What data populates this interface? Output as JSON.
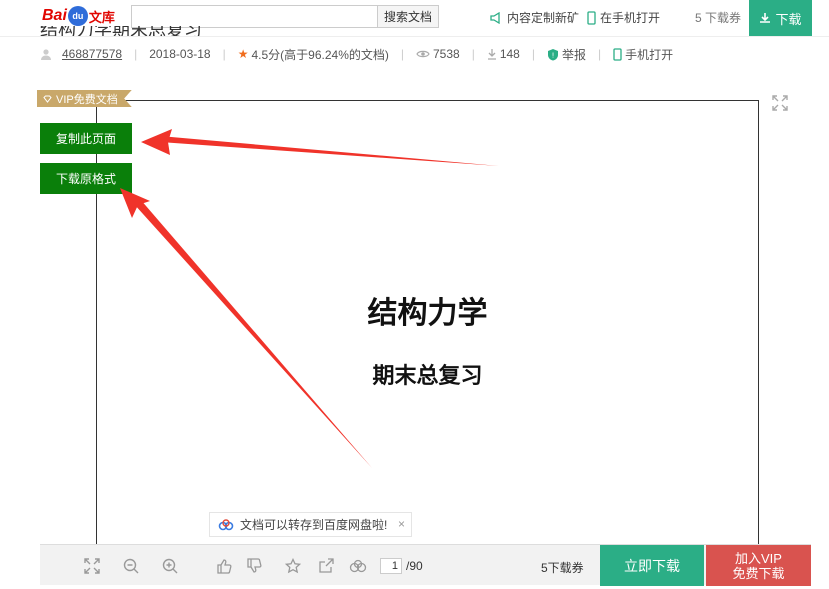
{
  "header": {
    "logo_left": "Bai",
    "logo_paw": "du",
    "logo_right": "文库",
    "search_placeholder": "",
    "search_button": "搜索文档",
    "custom_service": "内容定制新矿",
    "open_mobile": "在手机打开",
    "coupon": "5 下载券",
    "download": "下载"
  },
  "meta": {
    "title": "结构力学期末总复习",
    "author": "468877578",
    "date": "2018-03-18",
    "rating": "4.5分(高于96.24%的文档)",
    "views": "7538",
    "downloads": "148",
    "report": "举报",
    "mobile_open": "手机打开"
  },
  "doc": {
    "vip_tag": "VIP免费文档",
    "copy_page": "复制此页面",
    "download_original": "下载原格式",
    "title": "结构力学",
    "subtitle": "期末总复习"
  },
  "toast": {
    "message": "文档可以转存到百度网盘啦!",
    "close": "×"
  },
  "toolbar": {
    "current_page": "1",
    "total_pages": "/90",
    "coupon": "5下载券",
    "download_now": "立即下载",
    "vip_line1": "加入VIP",
    "vip_line2": "免费下载"
  },
  "colors": {
    "brand_red": "#e10601",
    "green": "#2bae86",
    "dark_green": "#0a7f0a",
    "vip_red": "#d9534f",
    "vip_gold": "#c9a86a",
    "arrow_red": "#f0332a"
  }
}
